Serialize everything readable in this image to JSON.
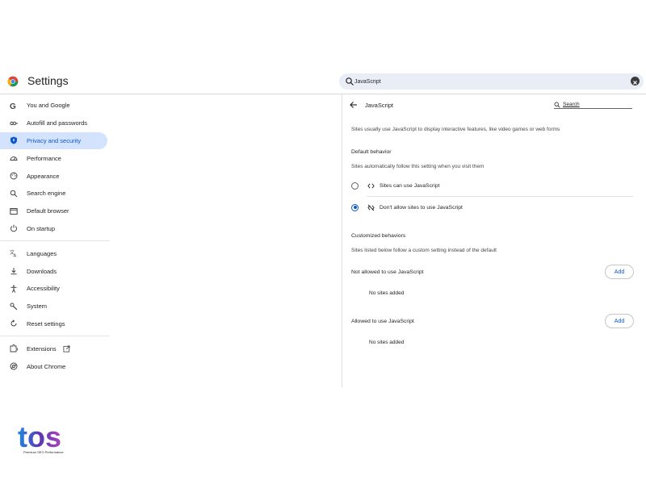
{
  "header": {
    "title": "Settings",
    "search_value": "JavaScript"
  },
  "sidebar": {
    "items": [
      {
        "label": "You and Google",
        "icon": "google-icon"
      },
      {
        "label": "Autofill and passwords",
        "icon": "key-icon"
      },
      {
        "label": "Privacy and security",
        "icon": "shield-icon",
        "active": true
      },
      {
        "label": "Performance",
        "icon": "speedometer-icon"
      },
      {
        "label": "Appearance",
        "icon": "palette-icon"
      },
      {
        "label": "Search engine",
        "icon": "search-icon"
      },
      {
        "label": "Default browser",
        "icon": "browser-icon"
      },
      {
        "label": "On startup",
        "icon": "power-icon"
      },
      {
        "label": "Languages",
        "icon": "translate-icon"
      },
      {
        "label": "Downloads",
        "icon": "download-icon"
      },
      {
        "label": "Accessibility",
        "icon": "accessibility-icon"
      },
      {
        "label": "System",
        "icon": "wrench-icon"
      },
      {
        "label": "Reset settings",
        "icon": "reset-icon"
      },
      {
        "label": "Extensions",
        "icon": "puzzle-icon"
      },
      {
        "label": "About Chrome",
        "icon": "chrome-icon"
      }
    ]
  },
  "main": {
    "title": "JavaScript",
    "search_placeholder": "Search",
    "description": "Sites usually use JavaScript to display interactive features, like video games or web forms",
    "default_behavior": {
      "title": "Default behavior",
      "subtitle": "Sites automatically follow this setting when you visit them",
      "options": [
        {
          "label": "Sites can use JavaScript",
          "icon": "code-icon",
          "checked": false
        },
        {
          "label": "Don't allow sites to use JavaScript",
          "icon": "code-off-icon",
          "checked": true
        }
      ]
    },
    "customized": {
      "title": "Customized behaviors",
      "subtitle": "Sites listed below follow a custom setting instead of the default",
      "not_allowed_label": "Not allowed to use JavaScript",
      "allowed_label": "Allowed to use JavaScript",
      "add_label": "Add",
      "empty_label": "No sites added"
    }
  },
  "brand": {
    "logo_text": "tos",
    "tagline": "Premium SEO Performance"
  },
  "colors": {
    "accent": "#0b57d0",
    "active_bg": "#d3e3fd",
    "search_bg": "#e9eef6"
  }
}
